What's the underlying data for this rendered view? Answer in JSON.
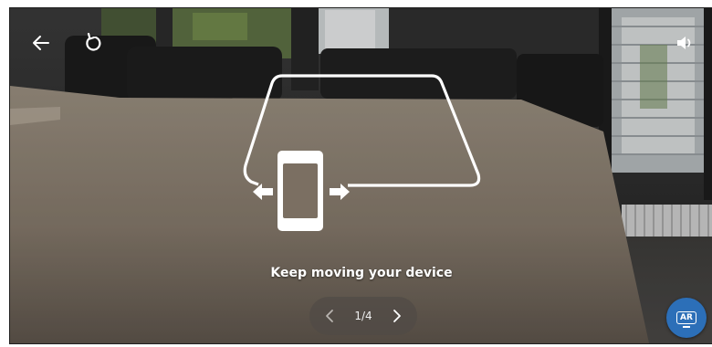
{
  "top_bar": {
    "back_icon": "arrow-left-icon",
    "reset_icon": "rotate-ccw-icon",
    "sound_icon": "speaker-icon"
  },
  "guide": {
    "illustration_icon": "move-device-guide-icon",
    "message": "Keep moving your device"
  },
  "pager": {
    "prev_icon": "chevron-left-icon",
    "next_icon": "chevron-right-icon",
    "count": "1/4",
    "current": 1,
    "total": 4
  },
  "ar_button": {
    "label": "AR",
    "color": "#2c6fb8"
  }
}
